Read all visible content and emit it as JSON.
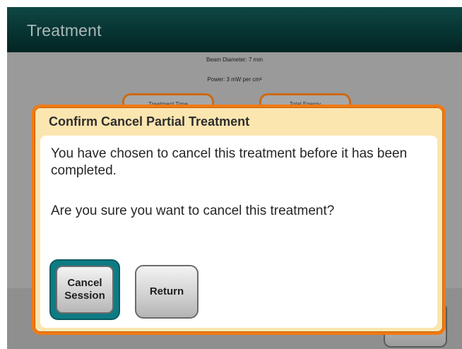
{
  "header": {
    "title": "Treatment"
  },
  "background": {
    "beam_diameter": "Beam Diameter: 7 mm",
    "power": "Power: 3 mW per cm²",
    "card_1_label": "Treatment Time",
    "card_2_label": "Total Energy"
  },
  "dialog": {
    "title": "Confirm Cancel Partial Treatment",
    "message_1": "You have chosen to cancel this treatment before it has been completed.",
    "message_2": "Are you sure you want to cancel this treatment?",
    "cancel_line1": "Cancel",
    "cancel_line2": "Session",
    "return_label": "Return"
  },
  "colors": {
    "header": "#073432",
    "dialog_border": "#f07a14",
    "dialog_title_bg": "#fbe6b0",
    "cancel_highlight": "#0e7b84"
  }
}
